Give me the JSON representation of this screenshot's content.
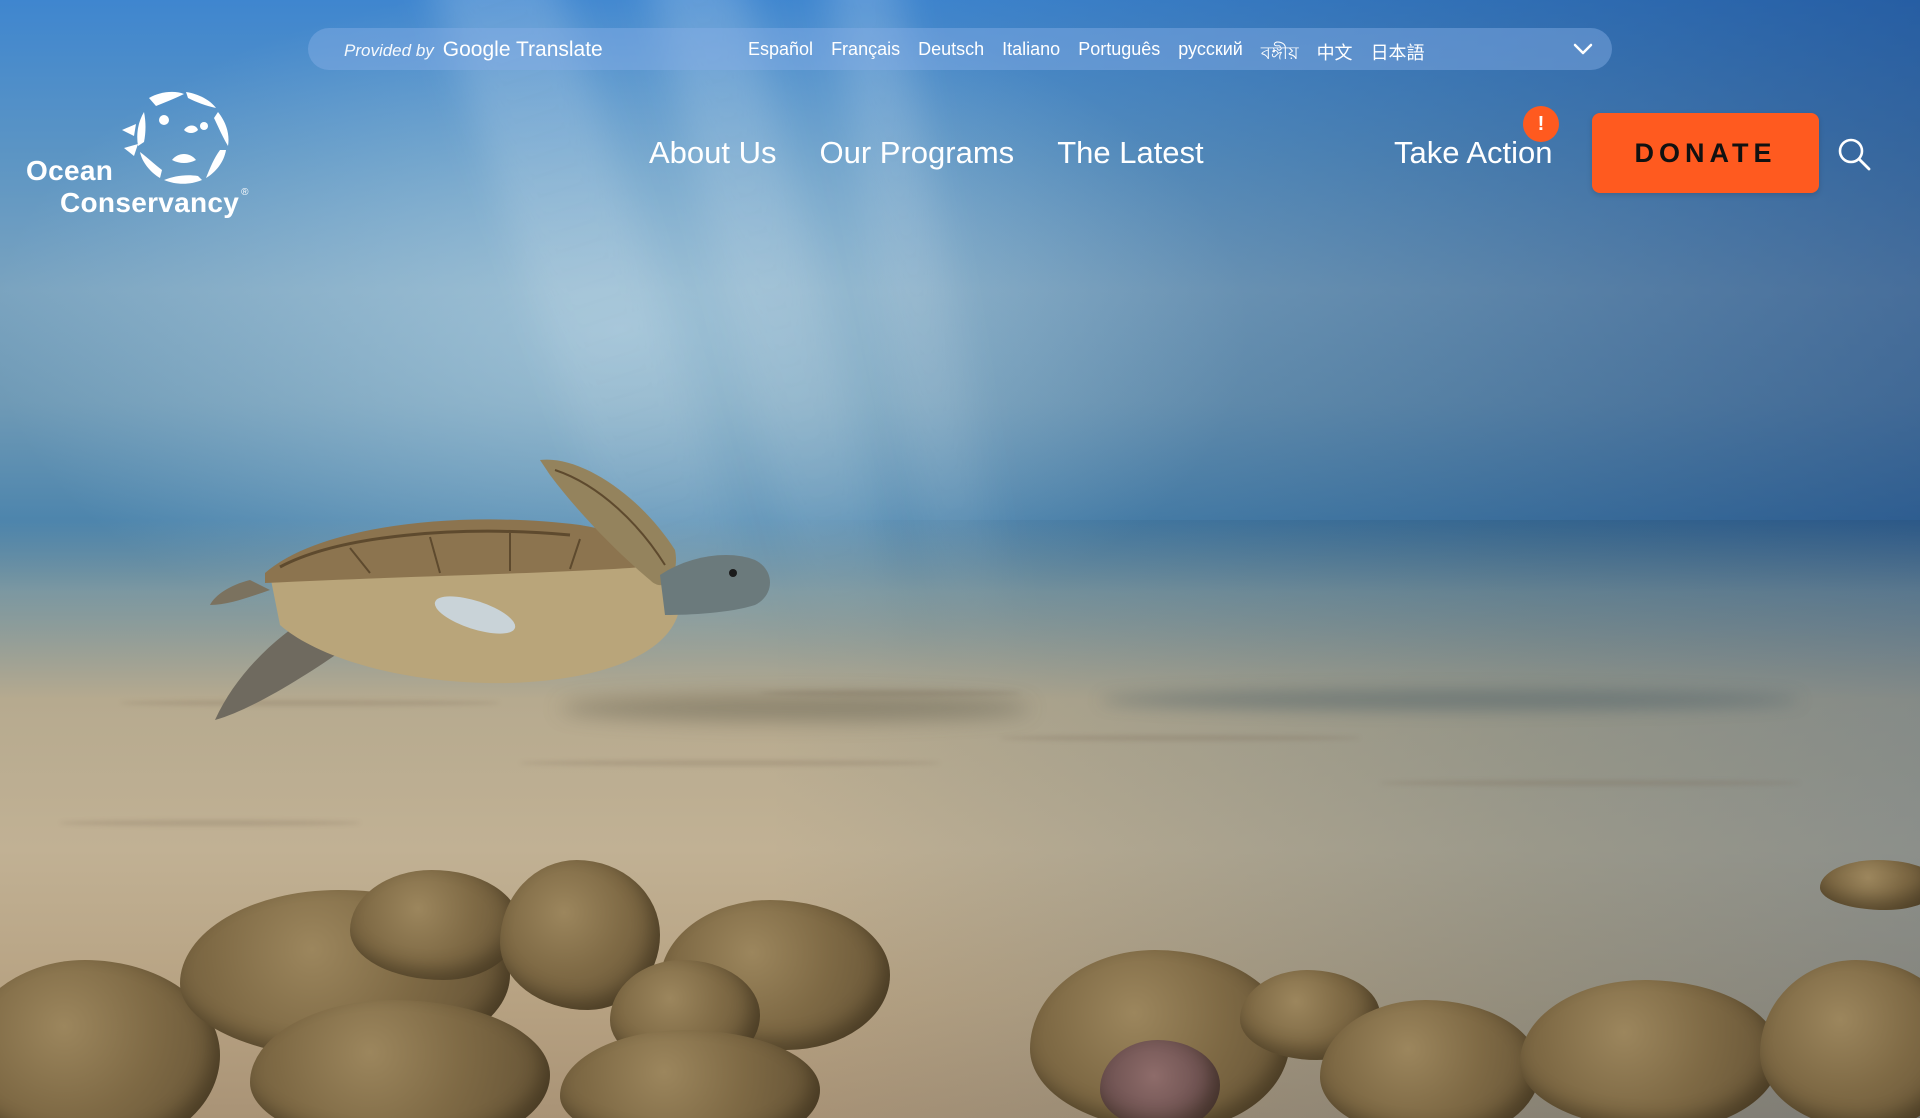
{
  "translate": {
    "provided_by": "Provided by",
    "google_translate": "Google Translate",
    "languages": [
      "Español",
      "Français",
      "Deutsch",
      "Italiano",
      "Português",
      "русский",
      "বঙ্গীয়",
      "中文",
      "日本語"
    ]
  },
  "logo": {
    "line1": "Ocean",
    "line2": "Conservancy",
    "registered": "®"
  },
  "nav": {
    "items": [
      "About Us",
      "Our Programs",
      "The Latest"
    ],
    "take_action": "Take Action",
    "alert_badge": "!",
    "donate": "DONATE"
  },
  "icons": {
    "search": "search-icon",
    "dropdown": "chevron-down-icon",
    "logo_mark": "sea-creatures-circle-icon"
  },
  "colors": {
    "accent": "#ff5a1f",
    "text_light": "#ffffff",
    "donate_text": "#111111"
  }
}
